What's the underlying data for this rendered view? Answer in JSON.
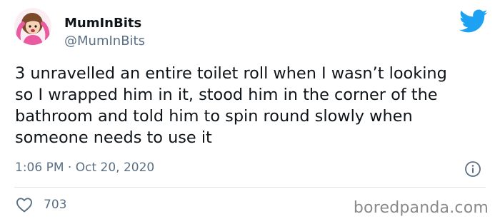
{
  "tweet": {
    "display_name": "MumInBits",
    "handle": "@MumInBits",
    "text": "3 unravelled an entire toilet roll when I wasn’t looking\nso I wrapped him in it, stood him in the corner of the\nbathroom and told him to spin round slowly when\nsomeone needs to use it",
    "timestamp": "1:06 PM · Oct 20, 2020",
    "like_count": "703"
  },
  "icons": {
    "avatar": "cartoon-woman-avatar",
    "brand": "twitter-bird-icon",
    "info": "info-icon",
    "like": "heart-icon"
  },
  "watermark": "boredpanda.com",
  "colors": {
    "brand_blue": "#1da1f2",
    "secondary_text": "#5b7083",
    "avatar_bg": "#fbeef2",
    "avatar_hair": "#7a4a2a",
    "avatar_shirt": "#ea5aa0"
  }
}
